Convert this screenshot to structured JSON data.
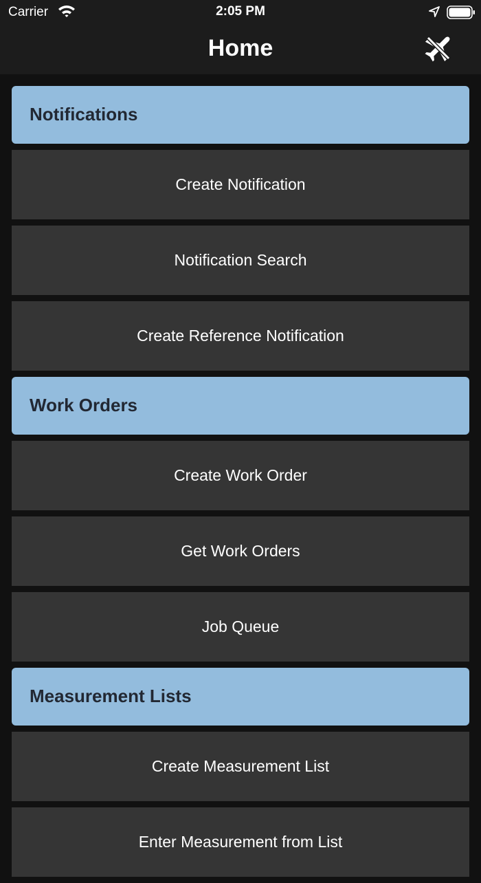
{
  "status_bar": {
    "carrier": "Carrier",
    "time": "2:05 PM",
    "icons": [
      "wifi-icon",
      "location-arrow-icon",
      "battery-icon"
    ]
  },
  "nav": {
    "title": "Home",
    "right_icon": "airplane-off-icon"
  },
  "colors": {
    "background": "#111111",
    "bar": "#1c1c1c",
    "section_header": "#93bcdd",
    "section_header_text": "#222833",
    "menu_item": "#353535",
    "text": "#ffffff"
  },
  "sections": [
    {
      "title": "Notifications",
      "items": [
        "Create Notification",
        "Notification Search",
        "Create Reference Notification"
      ]
    },
    {
      "title": "Work Orders",
      "items": [
        "Create Work Order",
        "Get Work Orders",
        "Job Queue"
      ]
    },
    {
      "title": "Measurement Lists",
      "items": [
        "Create Measurement List",
        "Enter Measurement from List"
      ]
    }
  ]
}
